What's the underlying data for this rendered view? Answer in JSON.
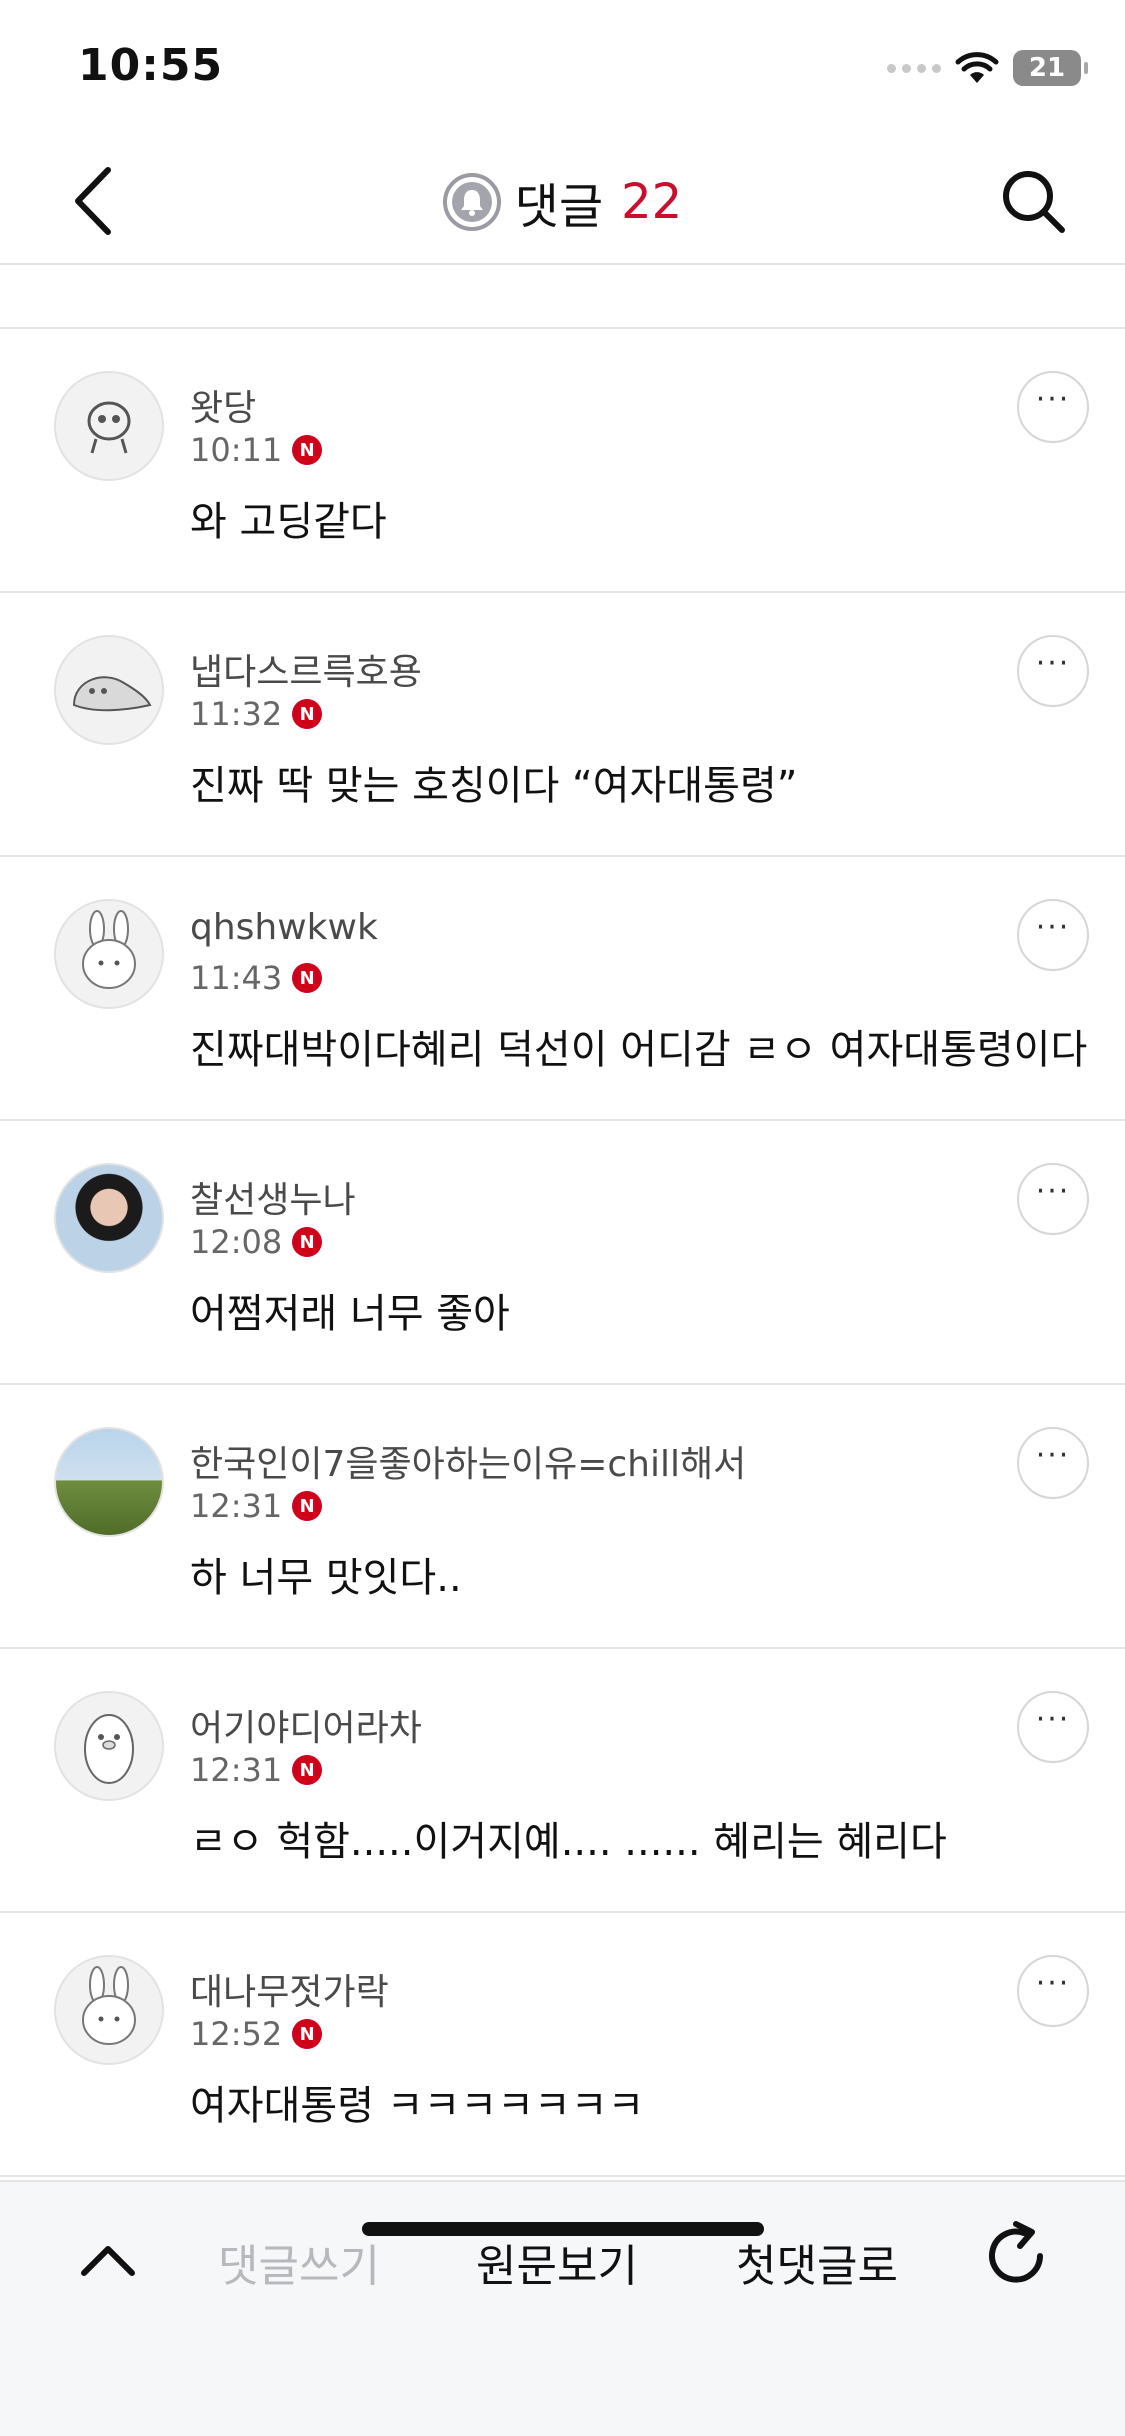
{
  "status_bar": {
    "time": "10:55",
    "battery": "21"
  },
  "header": {
    "title": "댓글",
    "count": "22"
  },
  "comments": [
    {
      "author": "왓당",
      "time": "10:11",
      "badge": "N",
      "text": "와 고딩같다"
    },
    {
      "author": "냅다스르륵호용",
      "time": "11:32",
      "badge": "N",
      "text": "진짜 딱 맞는 호칭이다 “여자대통령”"
    },
    {
      "author": "qhshwkwk",
      "time": "11:43",
      "badge": "N",
      "text": "진짜대박이다혜리 덕선이 어디감 ㄹㅇ 여자대통령이다"
    },
    {
      "author": "찰선생누나",
      "time": "12:08",
      "badge": "N",
      "text": "어쩜저래 너무 좋아"
    },
    {
      "author": "한국인이7을좋아하는이유=chill해서",
      "time": "12:31",
      "badge": "N",
      "text": "하 너무 맛잇다.."
    },
    {
      "author": "어기야디어라차",
      "time": "12:31",
      "badge": "N",
      "text": "ㄹㅇ 헉함.....이거지예.... ...... 혜리는 혜리다"
    },
    {
      "author": "대나무젓가락",
      "time": "12:52",
      "badge": "N",
      "text": "여자대통령 ㅋㅋㅋㅋㅋㅋㅋ"
    }
  ],
  "more_label": "···",
  "bottom_bar": {
    "write": "댓글쓰기",
    "original": "원문보기",
    "first": "첫댓글로"
  },
  "colors": {
    "accent": "#c8102e",
    "badge": "#d0021b",
    "disabled": "#b7b7bd"
  }
}
